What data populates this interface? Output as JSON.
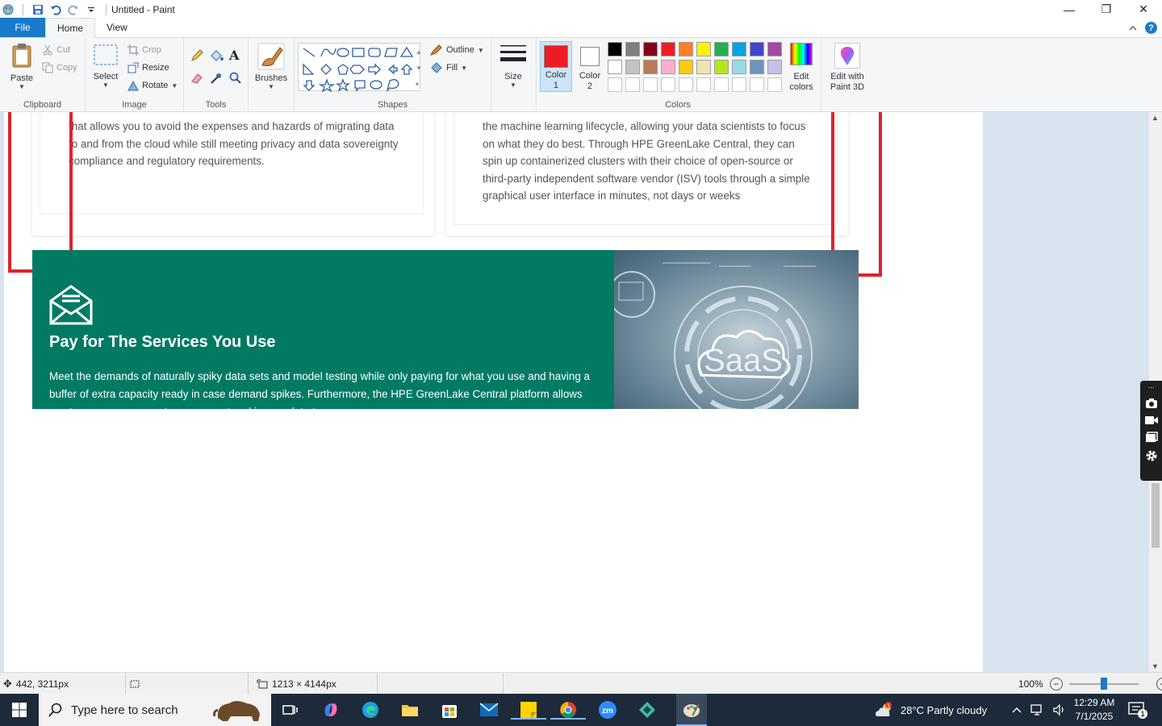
{
  "window": {
    "title": "Untitled - Paint",
    "controls": {
      "minimize": "—",
      "restore": "❐",
      "close": "✕"
    }
  },
  "tabs": {
    "file": "File",
    "home": "Home",
    "view": "View"
  },
  "ribbon": {
    "clipboard": {
      "label": "Clipboard",
      "paste": "Paste",
      "cut": "Cut",
      "copy": "Copy"
    },
    "image": {
      "label": "Image",
      "select": "Select",
      "crop": "Crop",
      "resize": "Resize",
      "rotate": "Rotate"
    },
    "tools": {
      "label": "Tools"
    },
    "brushes": {
      "label": "Brushes"
    },
    "shapes": {
      "label": "Shapes",
      "outline": "Outline",
      "fill": "Fill"
    },
    "size": {
      "label": "Size"
    },
    "colors": {
      "label": "Colors",
      "color1": "Color\n1",
      "color2": "Color\n2",
      "color1_value": "#ed1c24",
      "color2_value": "#ffffff",
      "edit_colors": "Edit\ncolors",
      "paint3d": "Edit with\nPaint 3D",
      "palette_row1": [
        "#000000",
        "#7f7f7f",
        "#880015",
        "#ed1c24",
        "#ff7f27",
        "#fff200",
        "#22b14c",
        "#00a2e8",
        "#3f48cc",
        "#a349a4"
      ],
      "palette_row2": [
        "#ffffff",
        "#c3c3c3",
        "#b97a57",
        "#ffaec9",
        "#ffc90e",
        "#efe4b0",
        "#b5e61d",
        "#99d9ea",
        "#7092be",
        "#c8bfe7"
      ]
    }
  },
  "content": {
    "card_left_text": "that allows you to avoid the expenses and hazards of migrating data to and from the cloud while still meeting privacy and data sovereignty compliance and regulatory requirements.",
    "card_right_text": "the machine learning lifecycle, allowing your data scientists to focus on what they do best. Through HPE GreenLake Central, they can spin up containerized clusters with their choice of open-source or third-party independent software vendor (ISV) tools through a simple graphical user interface in minutes, not days or weeks",
    "banner_title": "Pay for The Services You Use",
    "banner_text": "Meet the demands of naturally spiky data sets and model testing while only paying for what you use and having a buffer of extra capacity ready in case demand spikes. Furthermore, the HPE GreenLake Central platform allows you to see your usage at any moment and in complete transparency.",
    "saas_label": "SaaS"
  },
  "status": {
    "cursor_pos": "442, 3211px",
    "image_size": "1213 × 4144px",
    "zoom": "100%"
  },
  "taskbar": {
    "search_placeholder": "Type here to search",
    "weather": "28°C  Partly cloudy",
    "time": "12:29 AM",
    "date": "7/1/2025",
    "notification_count": "1"
  }
}
